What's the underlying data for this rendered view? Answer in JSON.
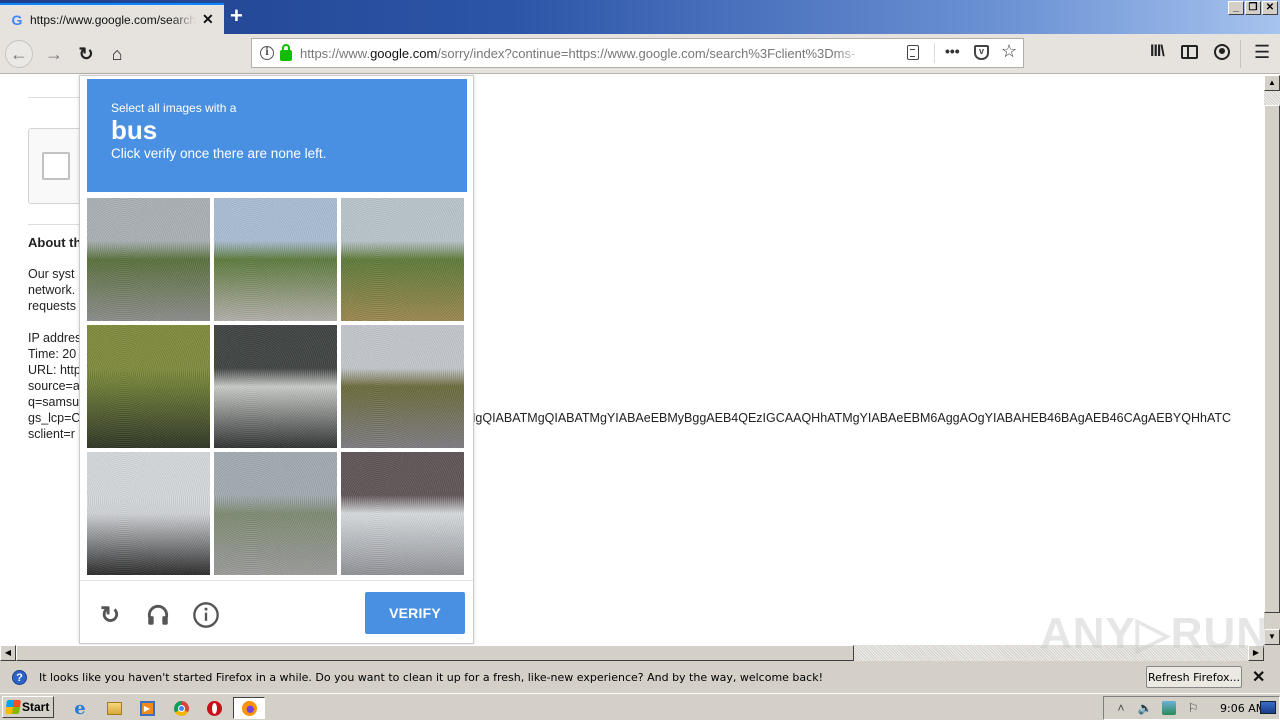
{
  "browser": {
    "tab": {
      "title": "https://www.google.com/search?client=ms-android",
      "favicon": "google-g-icon"
    },
    "url": {
      "prefix": "https://www.",
      "domain": "google.com",
      "path": "/sorry/index?continue=https://www.google.com/search%3Fclient%3Dms-"
    },
    "window_buttons": [
      "_",
      "❐",
      "✕"
    ]
  },
  "page": {
    "about_heading": "About th",
    "para1": [
      "Our syst",
      "network.",
      "requests"
    ],
    "para2": [
      "IP addres",
      "Time: 20",
      "URL: http",
      "source=a",
      "q=samsu",
      "gs_lcp=C",
      "sclient=r"
    ],
    "long_query": "MgQIABATMgQIABATMgYIABAeEBMyBggAEB4QEzIGCAAQHhATMgYIABAeEBM6AggAOgYIABAHEB46BAgAEB46CAgAEBYQHhATC"
  },
  "challenge": {
    "prompt": "Select all images with a",
    "target": "bus",
    "instruction": "Click verify once there are none left.",
    "tiles": [
      {
        "scene": "road with red vehicle and overpass",
        "colors": [
          "#a9b0b4",
          "#59703c",
          "#8c8c8c"
        ]
      },
      {
        "scene": "intersection with traffic lights and dark car",
        "colors": [
          "#a9bdd2",
          "#5d7a3d",
          "#b3afaa"
        ]
      },
      {
        "scene": "roadside with white truck and trees",
        "colors": [
          "#b9c3cb",
          "#5e7a38",
          "#9b874f"
        ]
      },
      {
        "scene": "grass field",
        "colors": [
          "#7f8a3c",
          "#6b7a36",
          "#2e3424"
        ]
      },
      {
        "scene": "crosswalk stripes",
        "colors": [
          "#3f4341",
          "#c9ccc8",
          "#2e3130"
        ]
      },
      {
        "scene": "tree lined road",
        "colors": [
          "#c2c7cc",
          "#6b6a3a",
          "#7d7b80"
        ]
      },
      {
        "scene": "palm trees against sky",
        "colors": [
          "#d4d8da",
          "#d0d3d6",
          "#2a2a2a"
        ]
      },
      {
        "scene": "highway with overpass",
        "colors": [
          "#a2aab0",
          "#7d8a72",
          "#9b9b9b"
        ]
      },
      {
        "scene": "underside of overpass",
        "colors": [
          "#5f5456",
          "#d8dcdf",
          "#8f9197"
        ]
      }
    ],
    "verify_label": "VERIFY",
    "footer_icons": [
      "reload-icon",
      "headphones-icon",
      "info-icon"
    ]
  },
  "notification": {
    "text": "It looks like you haven't started Firefox in a while. Do you want to clean it up for a fresh, like-new experience? And by the way, welcome back!",
    "button_label": "Refresh Firefox...",
    "close": "✕"
  },
  "watermark": "ANY▷RUN",
  "taskbar": {
    "start_label": "Start",
    "apps": [
      "internet-explorer",
      "file-explorer",
      "media-player",
      "chrome",
      "opera",
      "firefox"
    ],
    "clock": "9:06 AM"
  }
}
